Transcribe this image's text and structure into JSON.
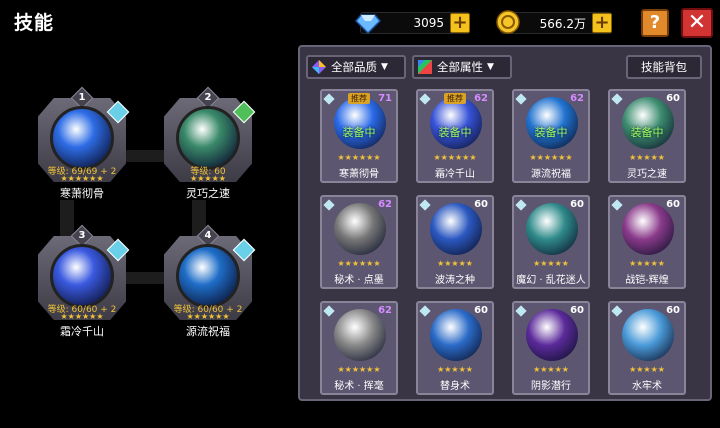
{
  "title": "技能",
  "currency": {
    "gems": "3095",
    "gold": "566.2万",
    "gem_icon": "diamond-icon",
    "gold_icon": "coin-icon",
    "plus": "+"
  },
  "buttons": {
    "help": "?",
    "close": "✕"
  },
  "equipped": [
    {
      "num": "1",
      "level": "等级: 69/69 + 2",
      "stars": "★★★★★★",
      "name": "寒萧彻骨",
      "color": "#2e6de6"
    },
    {
      "num": "2",
      "level": "等级: 60",
      "stars": "★★★★★",
      "name": "灵巧之速",
      "color": "#3a8a6a"
    },
    {
      "num": "3",
      "level": "等级: 60/60 + 2",
      "stars": "★★★★★★",
      "name": "霜冷千山",
      "color": "#3a5ae0"
    },
    {
      "num": "4",
      "level": "等级: 60/60 + 2",
      "stars": "★★★★★★",
      "name": "源流祝福",
      "color": "#1f6ec8"
    }
  ],
  "filters": {
    "quality": "全部品质",
    "attribute": "全部属性",
    "bag": "技能背包",
    "arrow": "▼"
  },
  "cards": [
    {
      "level": "71",
      "stars": "★★★★★★",
      "name": "寒萧彻骨",
      "tag": "推荐",
      "equipped": "装备中",
      "color": "#2a6ae8",
      "lvcolor": "#d58cff"
    },
    {
      "level": "62",
      "stars": "★★★★★★",
      "name": "霜冷千山",
      "tag": "推荐",
      "equipped": "装备中",
      "color": "#3753d8",
      "lvcolor": "#d58cff"
    },
    {
      "level": "62",
      "stars": "★★★★★★",
      "name": "源流祝福",
      "tag": "",
      "equipped": "装备中",
      "color": "#2173d0",
      "lvcolor": "#d58cff"
    },
    {
      "level": "60",
      "stars": "★★★★★",
      "name": "灵巧之速",
      "tag": "",
      "equipped": "装备中",
      "color": "#3c8d70",
      "lvcolor": "#ffffff"
    },
    {
      "level": "62",
      "stars": "★★★★★★",
      "name": "秘术 · 点墨",
      "tag": "",
      "equipped": "",
      "color": "#777777",
      "lvcolor": "#d58cff"
    },
    {
      "level": "60",
      "stars": "★★★★★",
      "name": "波涛之种",
      "tag": "",
      "equipped": "",
      "color": "#2b58c0",
      "lvcolor": "#ffffff"
    },
    {
      "level": "60",
      "stars": "★★★★★",
      "name": "魔幻 · 乱花迷人",
      "tag": "",
      "equipped": "",
      "color": "#2f8a8a",
      "lvcolor": "#ffffff"
    },
    {
      "level": "60",
      "stars": "★★★★★",
      "name": "战铠-辉煌",
      "tag": "",
      "equipped": "",
      "color": "#8a3a8a",
      "lvcolor": "#ffffff"
    },
    {
      "level": "62",
      "stars": "★★★★★★",
      "name": "秘术 · 挥毫",
      "tag": "",
      "equipped": "",
      "color": "#888888",
      "lvcolor": "#d58cff"
    },
    {
      "level": "60",
      "stars": "★★★★★",
      "name": "替身术",
      "tag": "",
      "equipped": "",
      "color": "#2b6bc8",
      "lvcolor": "#ffffff"
    },
    {
      "level": "60",
      "stars": "★★★★★",
      "name": "阴影潜行",
      "tag": "",
      "equipped": "",
      "color": "#5b2a9a",
      "lvcolor": "#ffffff"
    },
    {
      "level": "60",
      "stars": "★★★★★",
      "name": "水牢术",
      "tag": "",
      "equipped": "",
      "color": "#4a9ad8",
      "lvcolor": "#ffffff"
    }
  ]
}
